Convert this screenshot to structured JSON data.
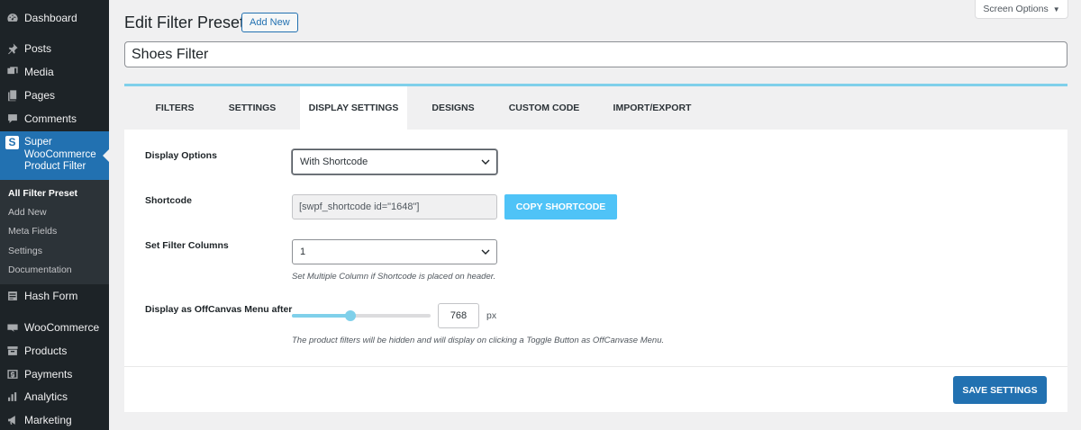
{
  "sidebar": {
    "items": [
      {
        "label": "Dashboard",
        "icon": "dashboard-icon"
      },
      {
        "label": "Posts",
        "icon": "pin-icon"
      },
      {
        "label": "Media",
        "icon": "media-icon"
      },
      {
        "label": "Pages",
        "icon": "page-icon"
      },
      {
        "label": "Comments",
        "icon": "comment-icon"
      },
      {
        "label": "Super WooCommerce Product Filter",
        "icon": "s-logo-icon"
      },
      {
        "label": "Hash Form",
        "icon": "form-icon"
      },
      {
        "label": "WooCommerce",
        "icon": "woo-icon"
      },
      {
        "label": "Products",
        "icon": "archive-icon"
      },
      {
        "label": "Payments",
        "icon": "dollar-icon"
      },
      {
        "label": "Analytics",
        "icon": "bar-chart-icon"
      },
      {
        "label": "Marketing",
        "icon": "megaphone-icon"
      }
    ],
    "submenu": [
      "All Filter Preset",
      "Add New",
      "Meta Fields",
      "Settings",
      "Documentation"
    ],
    "active_color": "#2271b1"
  },
  "header": {
    "title": "Edit Filter Preset",
    "add_new": "Add New",
    "screen_options": "Screen Options"
  },
  "post_title": "Shoes Filter",
  "tabs": [
    "FILTERS",
    "SETTINGS",
    "DISPLAY SETTINGS",
    "DESIGNS",
    "CUSTOM CODE",
    "IMPORT/EXPORT"
  ],
  "active_tab": "DISPLAY SETTINGS",
  "fields": {
    "display_options": {
      "label": "Display Options",
      "value": "With Shortcode"
    },
    "shortcode": {
      "label": "Shortcode",
      "value": "[swpf_shortcode id=\"1648\"]",
      "copy_label": "COPY SHORTCODE"
    },
    "filter_columns": {
      "label": "Set Filter Columns",
      "value": "1",
      "help": "Set Multiple Column if Shortcode is placed on header."
    },
    "offcanvas": {
      "label": "Display as OffCanvas Menu after",
      "value": "768",
      "unit": "px",
      "slider_fraction": 0.42,
      "help": "The product filters will be hidden and will display on clicking a Toggle Button as OffCanvase Menu."
    }
  },
  "save_label": "SAVE SETTINGS",
  "accent_color": "#7fd0ea",
  "copy_button_color": "#4fc3f7"
}
